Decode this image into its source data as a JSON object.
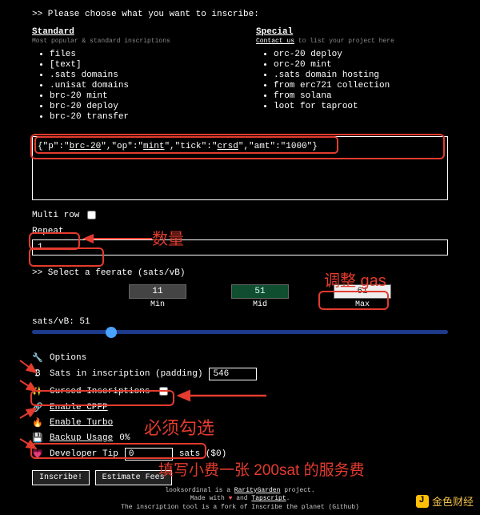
{
  "header": {
    "prompt": ">> Please choose what you want to inscribe:"
  },
  "standard": {
    "title": "Standard",
    "subtitle": "Most popular & standard inscriptions",
    "items": [
      "files",
      "[text]",
      ".sats domains",
      ".unisat domains",
      "brc-20 mint",
      "brc-20 deploy",
      "brc-20 transfer"
    ]
  },
  "special": {
    "title": "Special",
    "contact": "Contact us",
    "contact_suffix": " to list your project here",
    "items": [
      "orc-20 deploy",
      "orc-20 mint",
      ".sats domain hosting",
      "from erc721 collection",
      "from solana",
      "loot for taproot"
    ]
  },
  "json_text": "{\"p\":\"brc-20\",\"op\":\"mint\",\"tick\":\"crsd\",\"amt\":\"1000\"}",
  "multirow": {
    "label": "Multi row"
  },
  "repeat": {
    "label": "Repeat",
    "value": "1"
  },
  "feerate": {
    "label": ">> Select a feerate (sats/vB)",
    "min": {
      "value": "11",
      "label": "Min"
    },
    "mid": {
      "value": "51",
      "label": "Mid"
    },
    "max": {
      "value": "61",
      "label": "Max"
    },
    "current_label": "sats/vB: 51"
  },
  "options": {
    "header": "Options",
    "padding": {
      "label": "Sats in inscription (padding)",
      "value": "546"
    },
    "cursed": {
      "label": "Cursed Inscriptions"
    },
    "cpfp": {
      "label": "Enable CPFP"
    },
    "turbo": {
      "label": "Enable Turbo"
    },
    "backup": {
      "label": "Backup Usage",
      "value": "0%"
    },
    "tip": {
      "label": "Developer Tip",
      "value": "0",
      "suffix": "sats ($0)"
    }
  },
  "buttons": {
    "inscribe": "Inscribe!",
    "estimate": "Estimate Fees"
  },
  "footer": {
    "l1a": "looksordinal is a ",
    "l1b": "RarityGarden",
    "l1c": " project.",
    "l2a": "Made with ",
    "l2b": "♥",
    "l2c": " and ",
    "l2d": "Tapscript",
    "l2e": ".",
    "l3": "The inscription tool is a fork of Inscribe the planet (Github)"
  },
  "annotations": {
    "quantity": "数量",
    "gas": "调整 gas",
    "must_check": "必须勾选",
    "tip_note": "填写小费一张 200sat 的服务费"
  },
  "watermark": "金色财经"
}
